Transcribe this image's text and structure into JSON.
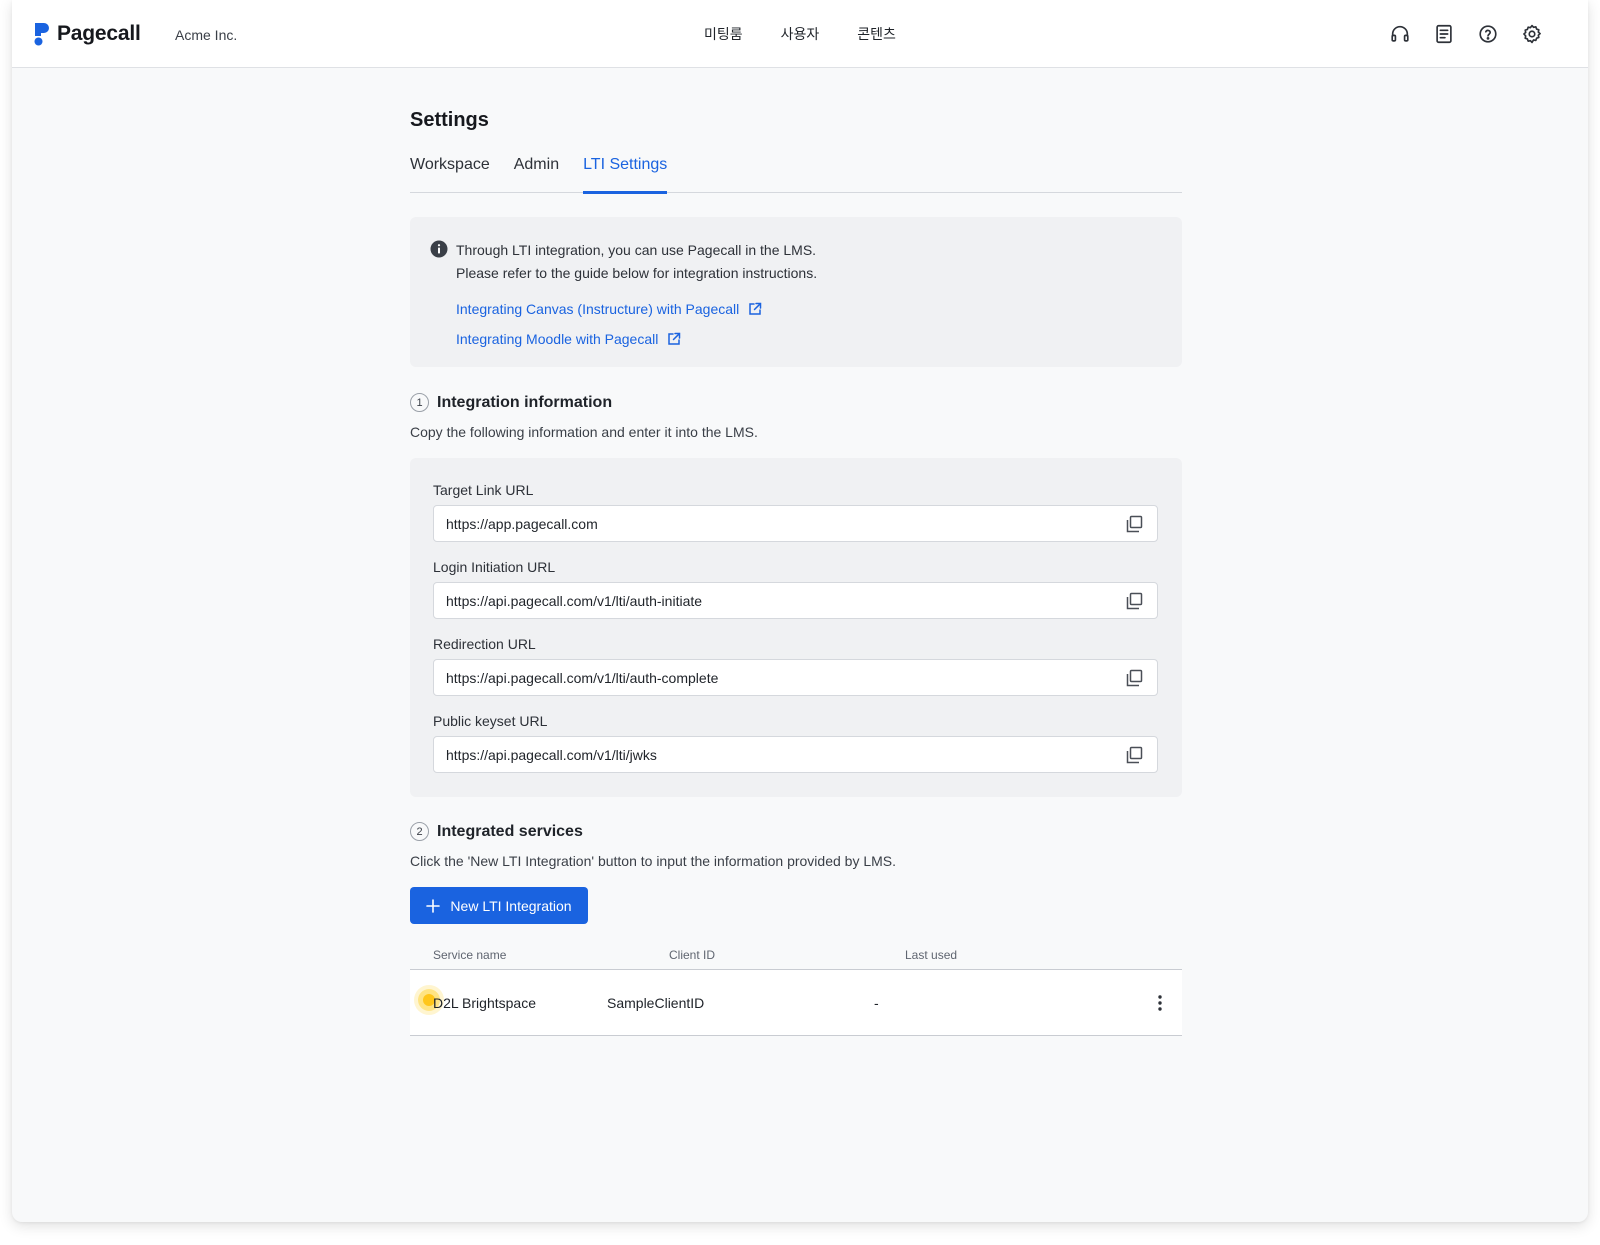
{
  "header": {
    "brand": "Pagecall",
    "org": "Acme Inc.",
    "nav": [
      "미팅룸",
      "사용자",
      "콘텐츠"
    ],
    "tools": [
      "headset-icon",
      "document-icon",
      "help-icon",
      "gear-icon"
    ]
  },
  "page": {
    "title": "Settings",
    "tabs": [
      {
        "label": "Workspace",
        "active": false
      },
      {
        "label": "Admin",
        "active": false
      },
      {
        "label": "LTI Settings",
        "active": true
      }
    ]
  },
  "info": {
    "line1": "Through LTI integration, you can use Pagecall in the LMS.",
    "line2": "Please refer to the guide below for integration instructions.",
    "links": [
      "Integrating Canvas (Instructure) with Pagecall",
      "Integrating Moodle with Pagecall"
    ]
  },
  "integration": {
    "number": "1",
    "title": "Integration information",
    "description": "Copy the following information and enter it into the LMS.",
    "fields": [
      {
        "label": "Target Link URL",
        "value": "https://app.pagecall.com"
      },
      {
        "label": "Login Initiation URL",
        "value": "https://api.pagecall.com/v1/lti/auth-initiate"
      },
      {
        "label": "Redirection URL",
        "value": "https://api.pagecall.com/v1/lti/auth-complete"
      },
      {
        "label": "Public keyset URL",
        "value": "https://api.pagecall.com/v1/lti/jwks"
      }
    ]
  },
  "services": {
    "number": "2",
    "title": "Integrated services",
    "description": "Click the 'New LTI Integration' button to input the information provided by LMS.",
    "new_button": "New LTI Integration",
    "columns": [
      "Service name",
      "Client ID",
      "Last used"
    ],
    "rows": [
      {
        "service_name": "D2L Brightspace",
        "client_id": "SampleClientID",
        "last_used": "-"
      }
    ]
  },
  "colors": {
    "accent": "#1a63e0",
    "cursor_highlight": "#ffc61a"
  }
}
